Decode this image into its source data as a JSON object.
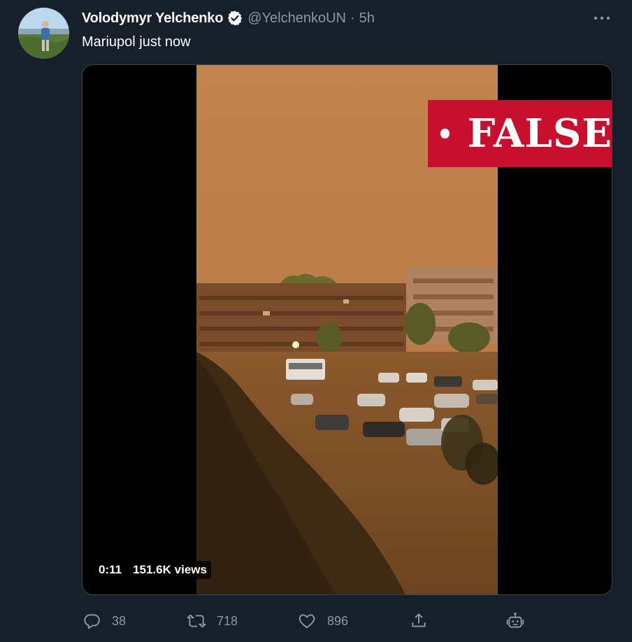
{
  "tweet": {
    "display_name": "Volodymyr Yelchenko",
    "handle": "@YelchenkoUN",
    "separator": "·",
    "time": "5h",
    "text": "Mariupol just now"
  },
  "media": {
    "badge_text": "FALSE",
    "badge_color": "#c8102e",
    "duration": "0:11",
    "views": "151.6K views"
  },
  "actions": {
    "reply_count": "38",
    "retweet_count": "718",
    "like_count": "896"
  },
  "icons": {
    "verified": "verified-badge-icon",
    "more": "more-options-icon",
    "reply": "reply-icon",
    "retweet": "retweet-icon",
    "like": "heart-icon",
    "share": "share-icon",
    "bot": "bot-icon"
  },
  "colors": {
    "background": "#15202b",
    "secondary_text": "#8899a6",
    "border": "#38444d"
  }
}
